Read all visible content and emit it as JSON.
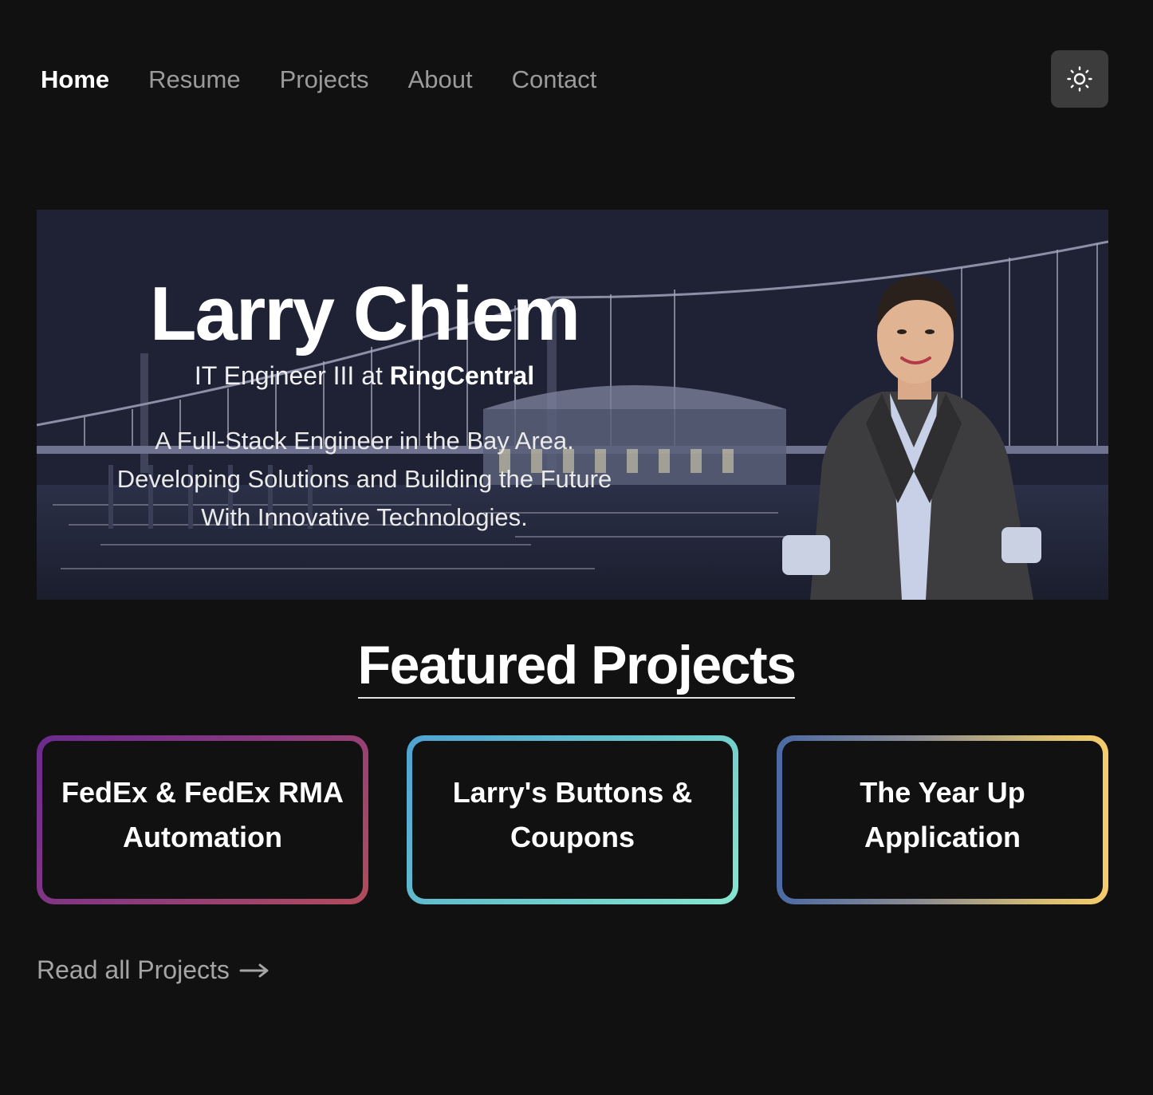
{
  "nav": {
    "items": [
      "Home",
      "Resume",
      "Projects",
      "About",
      "Contact"
    ],
    "active": "Home",
    "theme_icon": "sun-icon"
  },
  "hero": {
    "name": "Larry Chiem",
    "role_prefix": "IT Engineer III at ",
    "role_company": "RingCentral",
    "desc_lines": [
      "A Full-Stack Engineer in the Bay Area.",
      "Developing Solutions and Building the Future",
      "With Innovative Technologies."
    ]
  },
  "featured": {
    "title": "Featured Projects",
    "cards": [
      {
        "title": "FedEx & FedEx RMA Automation",
        "colors": [
          "#6b2a8f",
          "#b24c5c"
        ]
      },
      {
        "title": "Larry's Buttons & Coupons",
        "colors": [
          "#4fa3d3",
          "#86e6cf"
        ]
      },
      {
        "title": "The Year Up Application",
        "colors": [
          "#4b6aa5",
          "#f6cc6b"
        ]
      }
    ],
    "read_all": "Read all Projects",
    "read_all_icon": "arrow-right-icon"
  }
}
